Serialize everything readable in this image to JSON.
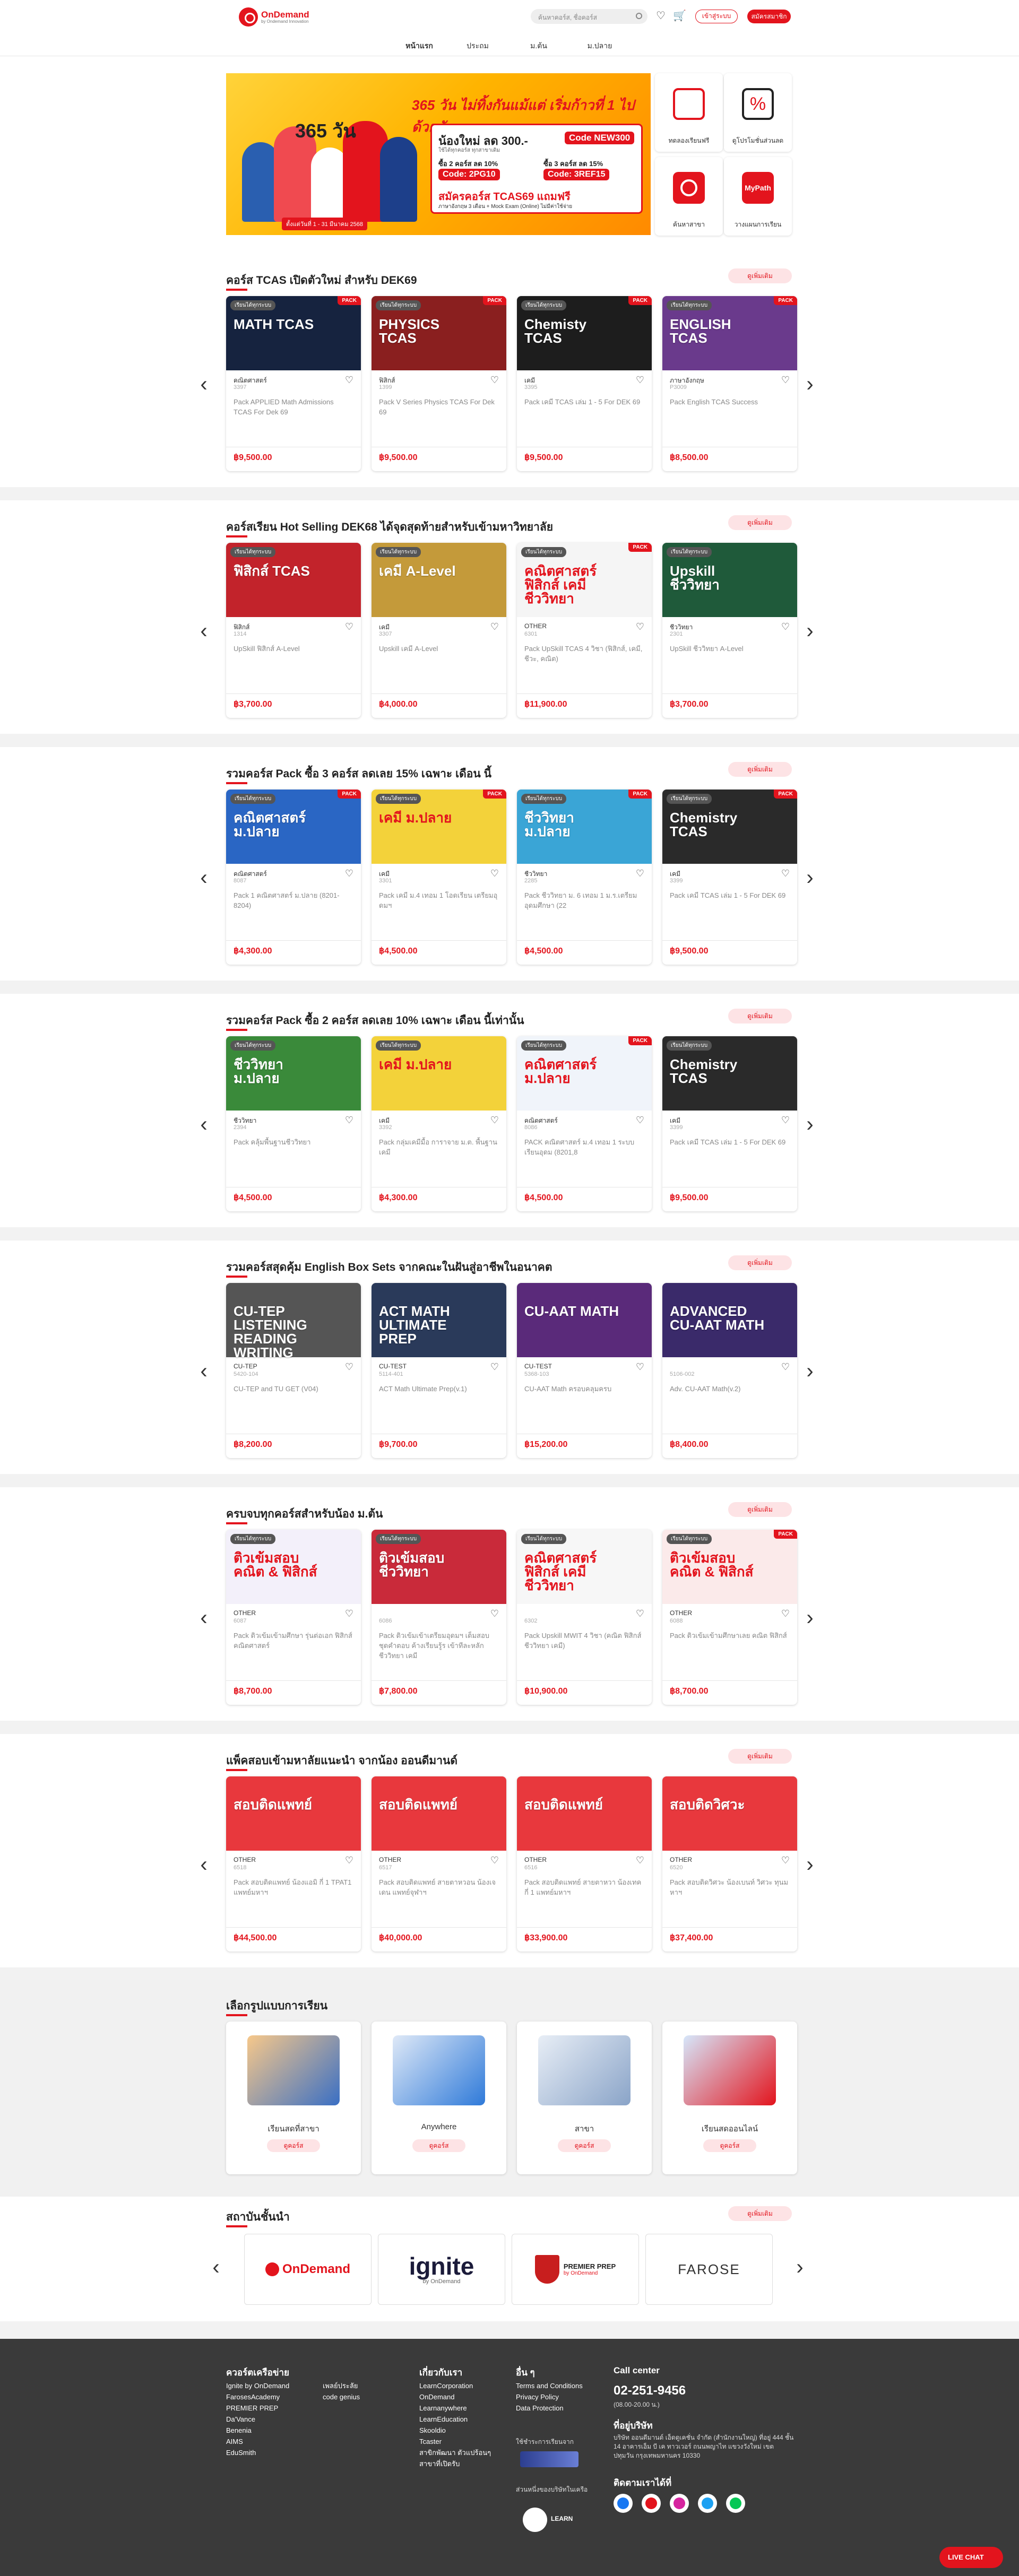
{
  "header": {
    "logo_name": "OnDemand",
    "logo_sub": "by Ondemand Innovation",
    "search_placeholder": "ค้นหาคอร์ส, ชื่อคอร์ส",
    "login_label": "เข้าสู่ระบบ",
    "register_label": "สมัครสมาชิก",
    "nav": [
      "หน้าแรก",
      "ประถม",
      "ม.ต้น",
      "ม.ปลาย"
    ]
  },
  "hero": {
    "headline": "365 วัน ไม่ทิ้งกันแม้แต่ เริ่มก้าวที่ 1 ไปด้วยกัน",
    "big_number": "365 วัน",
    "line1": "น้องใหม่ ลด 300.-",
    "line1_note": "ใช้ได้ทุกคอร์ส ทุกสาขาเดิม",
    "code1": "Code NEW300",
    "line2a": "ซื้อ 2 คอร์ส ลด 10%",
    "code2": "Code: 2PG10",
    "line2b": "ซื้อ 3 คอร์ส ลด 15%",
    "code3": "Code: 3REF15",
    "line3": "สมัครคอร์ส TCAS69 แถมฟรี",
    "line4": "ภาษาอังกฤษ 3 เดือน + Mock Exam (Online) ไม่มีค่าใช้จ่าย",
    "date": "ตั้งแต่วันที่ 1 - 31 มีนาคม 2568",
    "quick_links": [
      "ทดลองเรียนฟรี",
      "ดูโปรโมชั่นส่วนลด",
      "ค้นหาสาขา",
      "วางแผนการเรียน"
    ],
    "mypath": "MyPath"
  },
  "sections": [
    {
      "title": "คอร์ส TCAS เปิดตัวใหม่ สำหรับ DEK69",
      "see_all": "ดูเพิ่มเติม",
      "cards": [
        {
          "subject": "คณิตศาสตร์",
          "code": "3397",
          "name": "Pack APPLIED Math Admissions TCAS For Dek 69",
          "price": "฿9,500.00",
          "thumb": "MATH TCAS",
          "badge": "เรียนได้ทุกระบบ",
          "pack": "PACK"
        },
        {
          "subject": "ฟิสิกส์",
          "code": "1399",
          "name": "Pack V Series Physics TCAS For Dek 69",
          "price": "฿9,500.00",
          "thumb": "PHYSICS TCAS",
          "badge": "เรียนได้ทุกระบบ",
          "pack": "PACK"
        },
        {
          "subject": "เคมี",
          "code": "3395",
          "name": "Pack เคมี TCAS เล่ม 1 - 5 For DEK 69",
          "price": "฿9,500.00",
          "thumb": "Chemisty TCAS",
          "badge": "เรียนได้ทุกระบบ",
          "pack": "PACK"
        },
        {
          "subject": "ภาษาอังกฤษ",
          "code": "P3009",
          "name": "Pack English TCAS Success",
          "price": "฿8,500.00",
          "thumb": "ENGLISH TCAS",
          "badge": "เรียนได้ทุกระบบ",
          "pack": "PACK"
        }
      ]
    },
    {
      "title": "คอร์สเรียน Hot Selling DEK68 ได้จุดสุดท้ายสำหรับเข้ามหาวิทยาลัย",
      "see_all": "ดูเพิ่มเติม",
      "cards": [
        {
          "subject": "ฟิสิกส์",
          "code": "1314",
          "name": "UpSkill ฟิสิกส์ A-Level",
          "price": "฿3,700.00",
          "thumb": "ฟิสิกส์ TCAS",
          "badge": "เรียนได้ทุกระบบ",
          "pack": ""
        },
        {
          "subject": "เคมี",
          "code": "3307",
          "name": "Upskill เคมี A-Level",
          "price": "฿4,000.00",
          "thumb": "เคมี A-Level",
          "badge": "เรียนได้ทุกระบบ",
          "pack": ""
        },
        {
          "subject": "OTHER",
          "code": "6301",
          "name": "Pack UpSkill TCAS 4 วิชา (ฟิสิกส์, เคมี, ชีวะ, คณิต)",
          "price": "฿11,900.00",
          "thumb": "คณิตศาสตร์ ฟิสิกส์ เคมี ชีววิทยา",
          "badge": "เรียนได้ทุกระบบ",
          "pack": "PACK"
        },
        {
          "subject": "ชีววิทยา",
          "code": "2301",
          "name": "UpSkill ชีววิทยา A-Level",
          "price": "฿3,700.00",
          "thumb": "Upskill ชีววิทยา",
          "badge": "เรียนได้ทุกระบบ",
          "pack": ""
        }
      ]
    },
    {
      "title": "รวมคอร์ส Pack ซื้อ 3 คอร์ส ลดเลย 15% เฉพาะ เดือน นี้",
      "see_all": "ดูเพิ่มเติม",
      "cards": [
        {
          "subject": "คณิตศาสตร์",
          "code": "8087",
          "name": "Pack 1 คณิตศาสตร์ ม.ปลาย (8201-8204)",
          "price": "฿4,300.00",
          "thumb": "คณิตศาสตร์ ม.ปลาย",
          "badge": "เรียนได้ทุกระบบ",
          "pack": "PACK"
        },
        {
          "subject": "เคมี",
          "code": "3301",
          "name": "Pack เคมี ม.4 เทอม 1 โอดเรียน เตรียมอุดมฯ",
          "price": "฿4,500.00",
          "thumb": "เคมี ม.ปลาย",
          "badge": "เรียนได้ทุกระบบ",
          "pack": "PACK"
        },
        {
          "subject": "ชีววิทยา",
          "code": "2285",
          "name": "Pack ชีววิทยา ม. 6 เทอม 1 ม.ร.เตรียมอุดมศึกษา (22",
          "price": "฿4,500.00",
          "thumb": "ชีววิทยา ม.ปลาย",
          "badge": "เรียนได้ทุกระบบ",
          "pack": "PACK"
        },
        {
          "subject": "เคมี",
          "code": "3399",
          "name": "Pack เคมี TCAS เล่ม 1 - 5 For DEK 69",
          "price": "฿9,500.00",
          "thumb": "Chemistry TCAS",
          "badge": "เรียนได้ทุกระบบ",
          "pack": "PACK"
        }
      ]
    },
    {
      "title": "รวมคอร์ส Pack ซื้อ 2 คอร์ส ลดเลย 10% เฉพาะ เดือน นี้เท่านั้น",
      "see_all": "ดูเพิ่มเติม",
      "cards": [
        {
          "subject": "ชีววิทยา",
          "code": "2394",
          "name": "Pack คลุ้มพื้นฐานชีววิทยา",
          "price": "฿4,500.00",
          "thumb": "ชีววิทยา ม.ปลาย",
          "badge": "เรียนได้ทุกระบบ",
          "pack": ""
        },
        {
          "subject": "เคมี",
          "code": "3392",
          "name": "Pack กลุ่มเคมีมื้อ การาจาย ม.ต. พื้นฐานเคมี",
          "price": "฿4,300.00",
          "thumb": "เคมี ม.ปลาย",
          "badge": "เรียนได้ทุกระบบ",
          "pack": ""
        },
        {
          "subject": "คณิตศาสตร์",
          "code": "8086",
          "name": "PACK คณิตศาสตร์ ม.4 เทอม 1 ระบบเรียนอุดม (8201,8",
          "price": "฿4,500.00",
          "thumb": "คณิตศาสตร์ ม.ปลาย",
          "badge": "เรียนได้ทุกระบบ",
          "pack": "PACK"
        },
        {
          "subject": "เคมี",
          "code": "3399",
          "name": "Pack เคมี TCAS เล่ม 1 - 5 For DEK 69",
          "price": "฿9,500.00",
          "thumb": "Chemistry TCAS",
          "badge": "เรียนได้ทุกระบบ",
          "pack": ""
        }
      ]
    },
    {
      "title": "รวมคอร์สสุดคุ้ม English Box Sets จากคณะในฝันสู่อาชีพในอนาคต",
      "see_all": "ดูเพิ่มเติม",
      "cards": [
        {
          "subject": "CU-TEP",
          "code": "5420-104",
          "name": "CU-TEP and TU GET (V04)",
          "price": "฿8,200.00",
          "thumb": "CU-TEP LISTENING READING WRITING",
          "badge": "",
          "pack": ""
        },
        {
          "subject": "CU-TEST",
          "code": "5114-401",
          "name": "ACT Math Ultimate Prep(v.1)",
          "price": "฿9,700.00",
          "thumb": "ACT MATH ULTIMATE PREP",
          "badge": "",
          "pack": ""
        },
        {
          "subject": "CU-TEST",
          "code": "5368-103",
          "name": "CU-AAT Math ครอบคลุมครบ",
          "price": "฿15,200.00",
          "thumb": "CU-AAT MATH",
          "badge": "",
          "pack": ""
        },
        {
          "subject": "",
          "code": "5106-002",
          "name": "Adv. CU-AAT Math(v.2)",
          "price": "฿8,400.00",
          "thumb": "ADVANCED CU-AAT MATH",
          "badge": "",
          "pack": ""
        }
      ]
    },
    {
      "title": "ครบจบทุกคอร์สสำหรับน้อง ม.ต้น",
      "see_all": "ดูเพิ่มเติม",
      "cards": [
        {
          "subject": "OTHER",
          "code": "6087",
          "name": "Pack ติวเข้มเข้ามศึกษา รุ่นต่อเอก ฟิสิกส์คณิตศาสตร์",
          "price": "฿8,700.00",
          "thumb": "ติวเข้มสอบ คณิต & ฟิสิกส์",
          "badge": "เรียนได้ทุกระบบ",
          "pack": ""
        },
        {
          "subject": "",
          "code": "6086",
          "name": "Pack ติวเข้มเข้าเตรียมอุดมฯ เต็มสอบ ชุดคำตอบ ค้างเรียนรู้ร เข้าทีละหลัก ชีววิทยา เคมี",
          "price": "฿7,800.00",
          "thumb": "ติวเข้มสอบ ชีววิทยา",
          "badge": "เรียนได้ทุกระบบ",
          "pack": ""
        },
        {
          "subject": "",
          "code": "6302",
          "name": "Pack Upskill MWIT 4 วิชา (คณิต ฟิสิกส์ ชีววิทยา เคมี)",
          "price": "฿10,900.00",
          "thumb": "คณิตศาสตร์ ฟิสิกส์ เคมี ชีววิทยา",
          "badge": "เรียนได้ทุกระบบ",
          "pack": ""
        },
        {
          "subject": "OTHER",
          "code": "6088",
          "name": "Pack ติวเข้มเข้ามศึกษาเลย คณิต ฟิสิกส์",
          "price": "฿8,700.00",
          "thumb": "ติวเข้มสอบ คณิต & ฟิสิกส์",
          "badge": "เรียนได้ทุกระบบ",
          "pack": "PACK"
        }
      ]
    },
    {
      "title": "แพ็คสอบเข้ามหาลัยแนะนำ จากน้อง ออนดีมานด์",
      "see_all": "ดูเพิ่มเติม",
      "cards": [
        {
          "subject": "OTHER",
          "code": "6518",
          "name": "Pack สอบติดแพทย์ น้องแอมิ กี่ 1 TPAT1 แพทย์มหาฯ",
          "price": "฿44,500.00",
          "thumb": "สอบติดแพทย์",
          "badge": "",
          "pack": ""
        },
        {
          "subject": "OTHER",
          "code": "6517",
          "name": "Pack สอบติดแพทย์ สายตาหวอน น้องเจเดน แพทย์จุฬาฯ",
          "price": "฿40,000.00",
          "thumb": "สอบติดแพทย์",
          "badge": "",
          "pack": ""
        },
        {
          "subject": "OTHER",
          "code": "6516",
          "name": "Pack สอบติดแพทย์ สายตาหวา น้องเทค กี่ 1 แพทย์มหาฯ",
          "price": "฿33,900.00",
          "thumb": "สอบติดแพทย์",
          "badge": "",
          "pack": ""
        },
        {
          "subject": "OTHER",
          "code": "6520",
          "name": "Pack สอบติดวิศวะ น้องเบนท์ วิศวะ ทุนมหาฯ",
          "price": "฿37,400.00",
          "thumb": "สอบติดวิศวะ",
          "badge": "",
          "pack": ""
        }
      ]
    }
  ],
  "study_modes": {
    "title": "เลือกรูปแบบการเรียน",
    "items": [
      {
        "label": "เรียนสดที่สาขา",
        "btn": "ดูคอร์ส"
      },
      {
        "label": "Anywhere",
        "btn": "ดูคอร์ส"
      },
      {
        "label": "สาขา",
        "btn": "ดูคอร์ส"
      },
      {
        "label": "เรียนสดออนไลน์",
        "btn": "ดูคอร์ส"
      }
    ]
  },
  "institutes": {
    "title": "สถาบันชั้นนำ",
    "see_all": "ดูเพิ่มเติม",
    "items": [
      "OnDemand",
      "ignite",
      "PREMIER PREP",
      "FAROSE"
    ],
    "ignite_sub": "by OnDemand",
    "premier_sub": "by OnDemand"
  },
  "footer": {
    "col1_title": "ควอร์ตเครือข่าย",
    "col1_a": [
      "Ignite by OnDemand",
      "FarosesAcademy",
      "PREMIER PREP",
      "Da'Vance",
      "Benenia",
      "AIMS",
      "EduSmith"
    ],
    "col1_b": [
      "เพลย์ประลัย",
      "code genius"
    ],
    "col2_title": "เกี่ยวกับเรา",
    "col2": [
      "LearnCorporation",
      "OnDemand",
      "Learnanywhere",
      "LearnEducation",
      "Skooldio",
      "Tcaster",
      "สาขิกพัฒนา ตัวแปร้อนๆ",
      "สาขาที่เปิดรับ"
    ],
    "col3_title": "อื่น ๆ",
    "col3": [
      "Terms and Conditions",
      "Privacy Policy",
      "Data Protection"
    ],
    "payment_title": "ใช้ชำระการเรียนจาก",
    "partner_title": "ส่วนหนึ่งของบริษัทในเครือ",
    "partner_name": "LEARN",
    "contact_title": "Call center",
    "phone": "02-251-9456",
    "hours": "(08.00-20.00 น.)",
    "address_title": "ที่อยู่บริษัท",
    "address": "บริษัท ออนดีมานด์ เอ็ดดูเคชั่น จำกัด (สำนักงานใหญ่) ที่อยู่ 444 ชั้น 14 อาคารเอ็ม บี เค ทาวเวอร์ ถนนพญาไท แขวงวังใหม่ เขตปทุมวัน กรุงเทพมหานคร 10330",
    "follow_title": "ติดตามเราได้ที่",
    "livechat": "LIVE CHAT"
  }
}
